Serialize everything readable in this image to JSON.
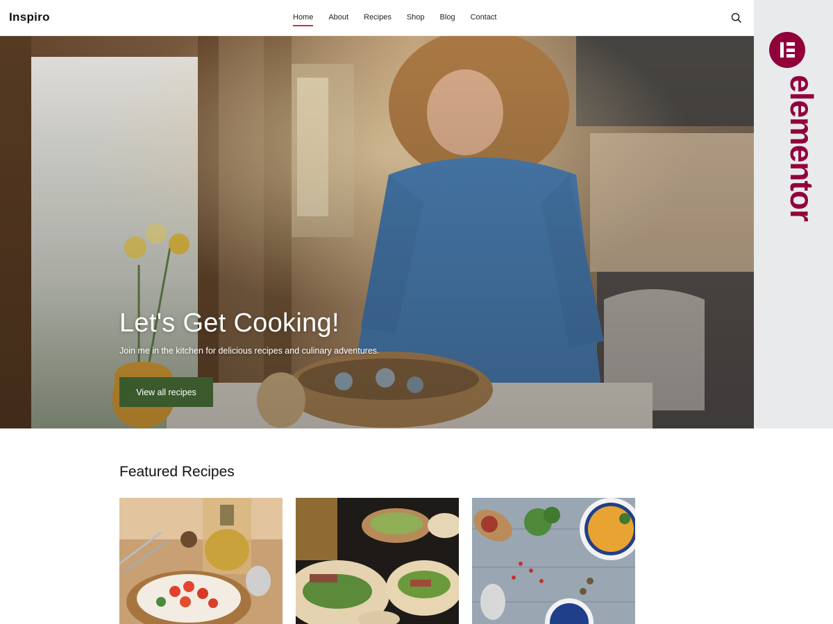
{
  "header": {
    "logo": "Inspiro",
    "nav": [
      {
        "label": "Home",
        "active": true
      },
      {
        "label": "About",
        "active": false
      },
      {
        "label": "Recipes",
        "active": false
      },
      {
        "label": "Shop",
        "active": false
      },
      {
        "label": "Blog",
        "active": false
      },
      {
        "label": "Contact",
        "active": false
      }
    ],
    "search_icon": "search-icon"
  },
  "hero": {
    "title": "Let's Get Cooking!",
    "subtitle": "Join me in the kitchen for delicious recipes and culinary adventures.",
    "button_label": "View all recipes",
    "button_color": "#3a5a2e"
  },
  "side_panel": {
    "brand": "elementor",
    "brand_color": "#92003b",
    "icon": "elementor-logo-icon"
  },
  "featured": {
    "title": "Featured Recipes",
    "cards": [
      {
        "image": "bruschetta-photo"
      },
      {
        "image": "tacos-photo"
      },
      {
        "image": "soup-photo"
      }
    ]
  },
  "colors": {
    "accent_underline": "#c0392b"
  }
}
